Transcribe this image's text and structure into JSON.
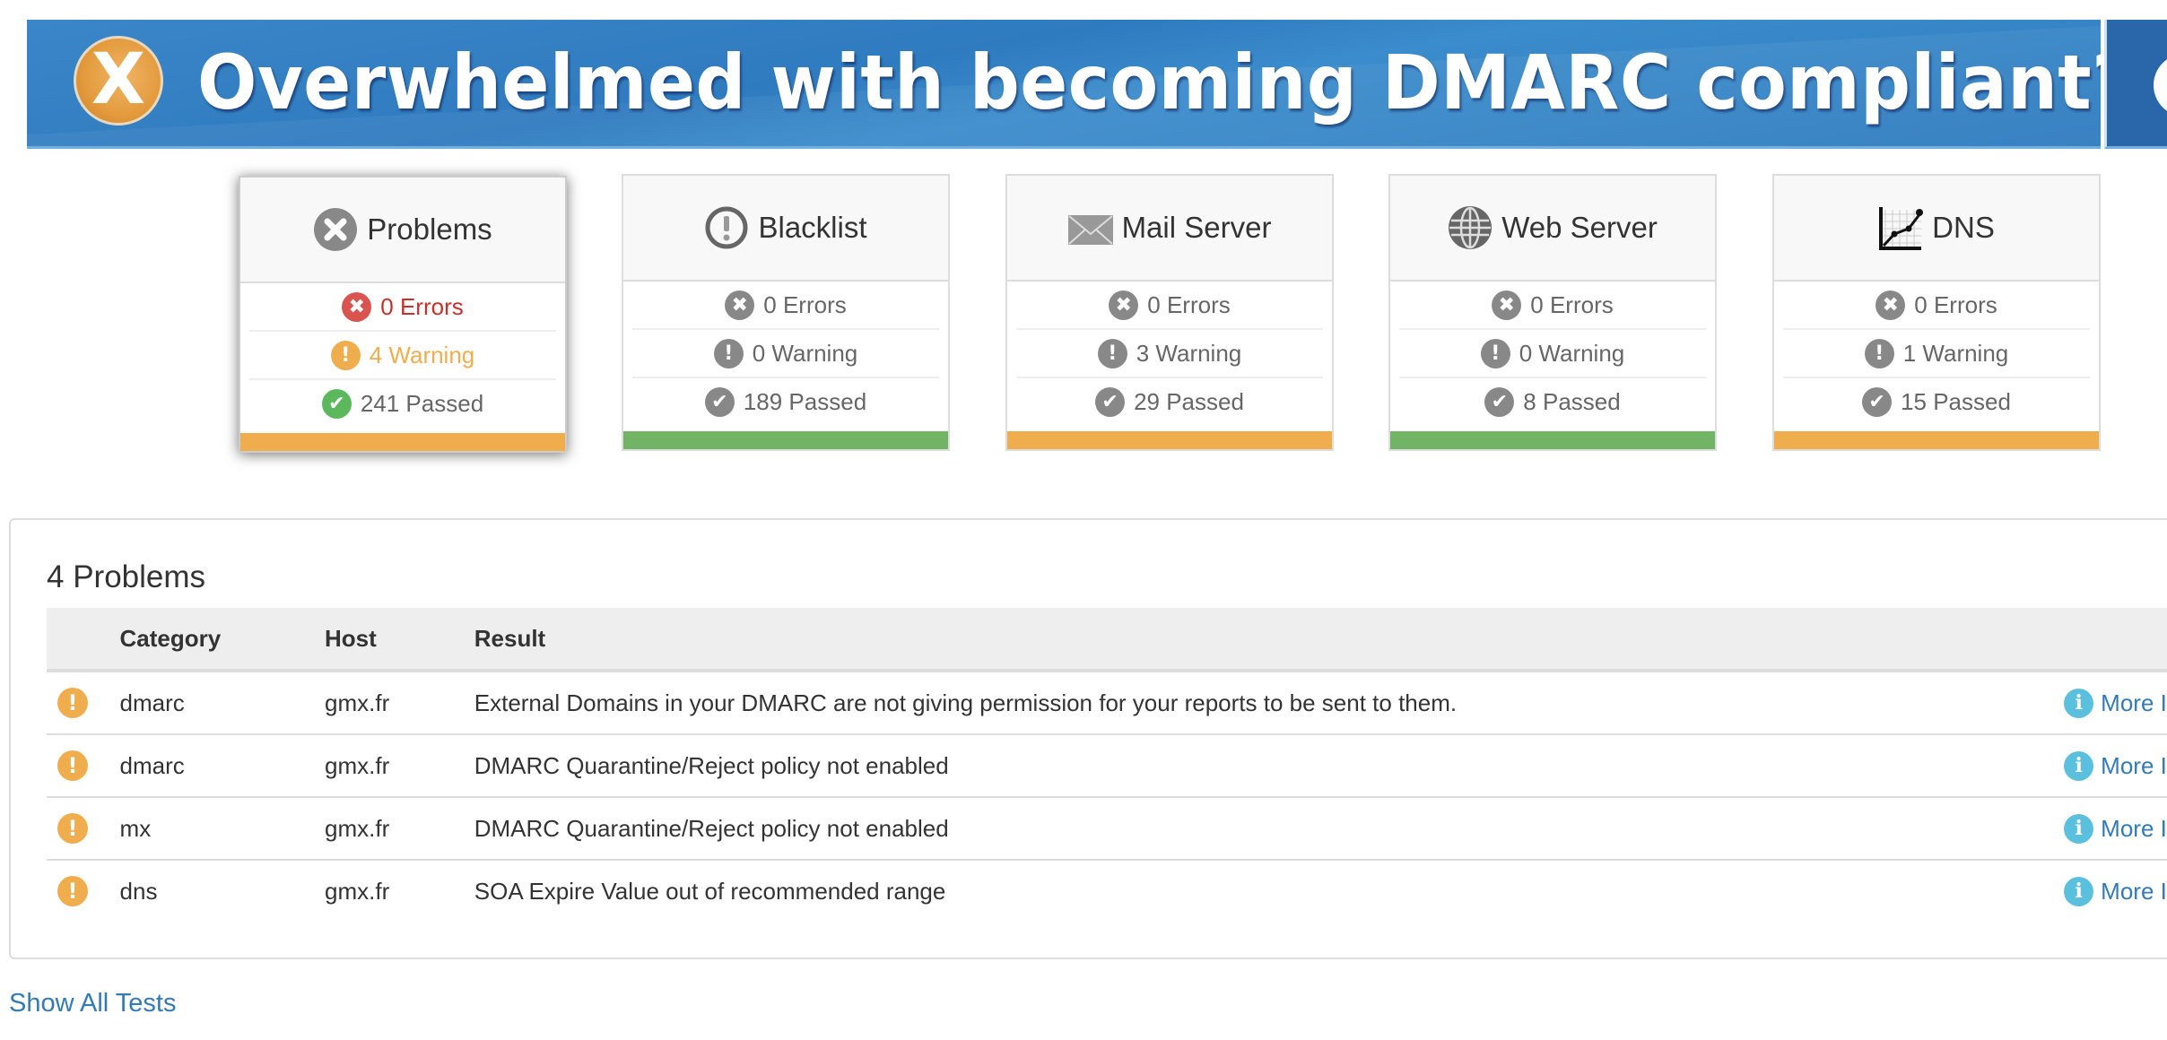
{
  "banner": {
    "badge_letter": "X",
    "headline": "Overwhelmed with becoming DMARC compliant?",
    "colors": {
      "background": "#2f7bbf",
      "badge": "#e39a3c",
      "secondary": "#2a67aa"
    }
  },
  "status_colors": {
    "error": "#d9534f",
    "warning": "#f0ad4e",
    "passed": "#5cb85c",
    "neutral": "#888888",
    "link": "#337ab7",
    "info": "#5bc0de"
  },
  "cards": [
    {
      "title": "Problems",
      "icon": "x-circle-icon",
      "errors": "0 Errors",
      "warnings": "4 Warning",
      "passed": "241 Passed",
      "status": "warning",
      "bar_color": "#f0ad4e",
      "selected": true
    },
    {
      "title": "Blacklist",
      "icon": "exclamation-circle-outline-icon",
      "errors": "0 Errors",
      "warnings": "0 Warning",
      "passed": "189 Passed",
      "status": "ok",
      "bar_color": "#72b465",
      "selected": false
    },
    {
      "title": "Mail Server",
      "icon": "envelope-icon",
      "errors": "0 Errors",
      "warnings": "3 Warning",
      "passed": "29 Passed",
      "status": "warning",
      "bar_color": "#f0ad4e",
      "selected": false
    },
    {
      "title": "Web Server",
      "icon": "globe-icon",
      "errors": "0 Errors",
      "warnings": "0 Warning",
      "passed": "8 Passed",
      "status": "ok",
      "bar_color": "#72b465",
      "selected": false
    },
    {
      "title": "DNS",
      "icon": "line-chart-icon",
      "errors": "0 Errors",
      "warnings": "1 Warning",
      "passed": "15 Passed",
      "status": "warning",
      "bar_color": "#f0ad4e",
      "selected": false
    }
  ],
  "problems": {
    "title": "4 Problems",
    "columns": [
      "",
      "Category",
      "Host",
      "Result",
      ""
    ],
    "rows": [
      {
        "severity": "warning",
        "category": "dmarc",
        "host": "gmx.fr",
        "result": "External Domains in your DMARC are not giving permission for your reports to be sent to them.",
        "link": "More Info"
      },
      {
        "severity": "warning",
        "category": "dmarc",
        "host": "gmx.fr",
        "result": "DMARC Quarantine/Reject policy not enabled",
        "link": "More Info"
      },
      {
        "severity": "warning",
        "category": "mx",
        "host": "gmx.fr",
        "result": "DMARC Quarantine/Reject policy not enabled",
        "link": "More Info"
      },
      {
        "severity": "warning",
        "category": "dns",
        "host": "gmx.fr",
        "result": "SOA Expire Value out of recommended range",
        "link": "More Info"
      }
    ]
  },
  "footer": {
    "show_all_label": "Show All Tests"
  },
  "glyphs": {
    "error": "✖",
    "warning": "!",
    "passed": "✔",
    "info": "i"
  }
}
